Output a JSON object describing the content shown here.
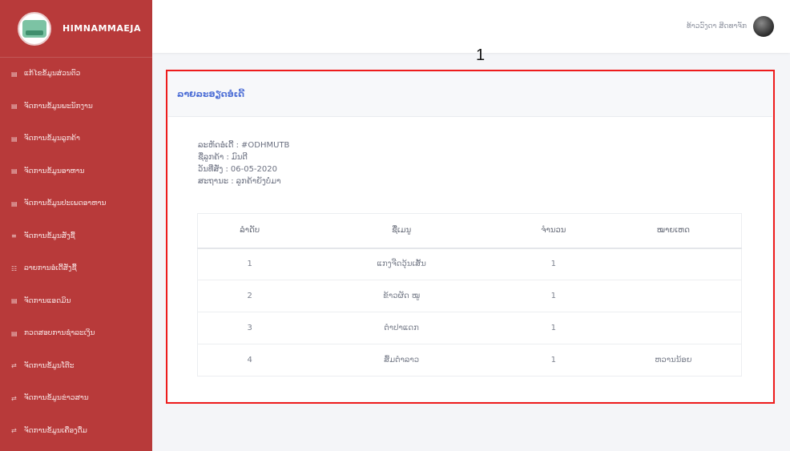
{
  "sidebar": {
    "brand": "HIMNAMMAEJA",
    "items": [
      {
        "icon": "▤",
        "label": "ແກ້ໄຂຂໍ້ມູນສ່ວນຕົວ"
      },
      {
        "icon": "▤",
        "label": "ຈັດການຂໍ້ມູນພະນັກງານ"
      },
      {
        "icon": "▤",
        "label": "ຈັດການຂໍ້ມູນລູກຄ້າ"
      },
      {
        "icon": "▤",
        "label": "ຈັດການຂໍ້ມູນອາຫານ"
      },
      {
        "icon": "▤",
        "label": "ຈັດການຂໍ້ມູນປະເພດອາຫານ"
      },
      {
        "icon": "≡",
        "label": "ຈັດການຂໍ້ມູນສັ່ງຊື້"
      },
      {
        "icon": "☷",
        "label": "ລາຍການອໍເດີ້ສັ່ງຊື້"
      },
      {
        "icon": "▤",
        "label": "ຈັດການແອດມິນ"
      },
      {
        "icon": "▤",
        "label": "ກວດສອບການຊຳລະເງິນ"
      },
      {
        "icon": "⇄",
        "label": "ຈັດການຂໍ້ມູນໂຕ໊ະ"
      },
      {
        "icon": "⇄",
        "label": "ຈັດການຂໍ້ມູນຂ່າວສານ"
      },
      {
        "icon": "⇄",
        "label": "ຈັດການຂໍ້ມູນເຄື່ອງດື່ມ"
      }
    ]
  },
  "topbar": {
    "user_name": "ທ້າວວົງດາ ສິດທາຈັກ"
  },
  "annotation": {
    "number": "1"
  },
  "card": {
    "title": "ລາຍລະອຽດອໍເດີ້",
    "order_code_label": "ລະຫັດອໍເດີ້ :",
    "order_code": "#ODHMUTB",
    "customer_label": "ຊື່ລູກຄ້າ :",
    "customer": "ມົນຕີ",
    "date_label": "ວັນທີ່ສັ່ງ :",
    "date": "06-05-2020",
    "status_label": "ສະຖານະ :",
    "status": "ລູກຄ້າຍັງບໍ່ມາ"
  },
  "table": {
    "headers": [
      "ລຳດັບ",
      "ຊື່ເມນູ",
      "ຈຳນວນ",
      "ໝາຍເຫດ"
    ],
    "rows": [
      [
        "1",
        "ແກງຈືດວຸ້ນເສັ້ນ",
        "1",
        ""
      ],
      [
        "2",
        "ຂ້າວຜັດ ໝູ",
        "1",
        ""
      ],
      [
        "3",
        "ຕຳປາແດກ",
        "1",
        ""
      ],
      [
        "4",
        "ສົ້ມຕຳລາວ",
        "1",
        "ຫວານນ້ອຍ"
      ]
    ]
  }
}
